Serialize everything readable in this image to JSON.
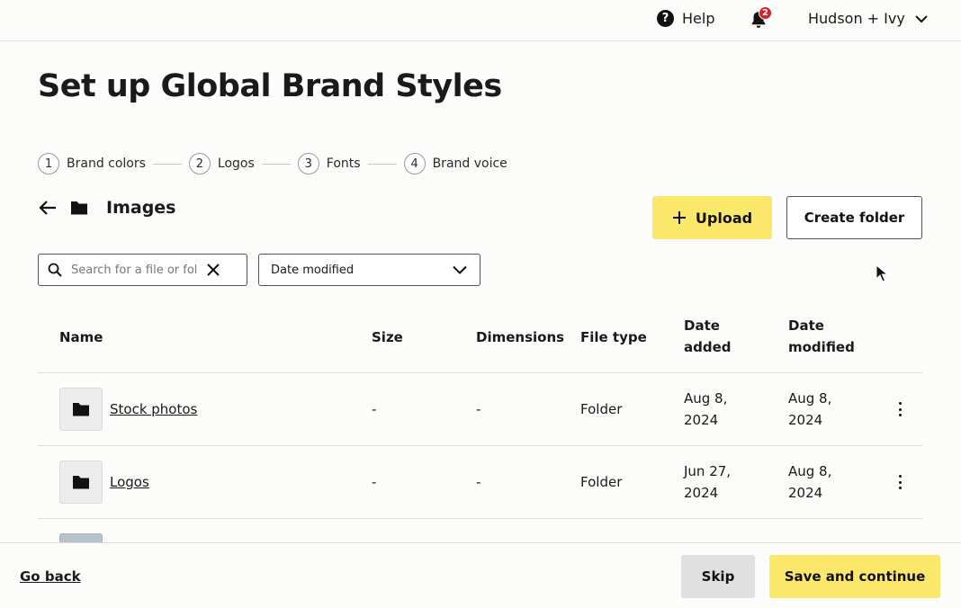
{
  "topbar": {
    "help_label": "Help",
    "help_glyph": "?",
    "notification_count": "2",
    "account_name": "Hudson + Ivy"
  },
  "page_title": "Set up Global Brand Styles",
  "steps": [
    {
      "number": "1",
      "label": "Brand colors"
    },
    {
      "number": "2",
      "label": "Logos"
    },
    {
      "number": "3",
      "label": "Fonts"
    },
    {
      "number": "4",
      "label": "Brand voice"
    }
  ],
  "folder": {
    "title": "Images"
  },
  "toolbar": {
    "upload_label": "Upload",
    "create_folder_label": "Create folder"
  },
  "filters": {
    "search_placeholder": "Search for a file or fol",
    "sort_value": "Date modified"
  },
  "table": {
    "columns": {
      "name": "Name",
      "size": "Size",
      "dimensions": "Dimensions",
      "file_type": "File type",
      "date_added_line1": "Date",
      "date_added_line2": "added",
      "date_modified_line1": "Date",
      "date_modified_line2": "modified"
    },
    "rows": [
      {
        "name": "Stock photos",
        "size": "-",
        "dimensions": "-",
        "file_type": "Folder",
        "added_1": "Aug 8,",
        "added_2": "2024",
        "modified_1": "Aug 8,",
        "modified_2": "2024"
      },
      {
        "name": "Logos",
        "size": "-",
        "dimensions": "-",
        "file_type": "Folder",
        "added_1": "Jun 27,",
        "added_2": "2024",
        "modified_1": "Aug 8,",
        "modified_2": "2024"
      }
    ]
  },
  "footer": {
    "go_back_label": "Go back",
    "skip_label": "Skip",
    "save_label": "Save and continue"
  },
  "colors": {
    "accent_yellow": "#fbe86a",
    "badge_red": "#d8202b"
  }
}
